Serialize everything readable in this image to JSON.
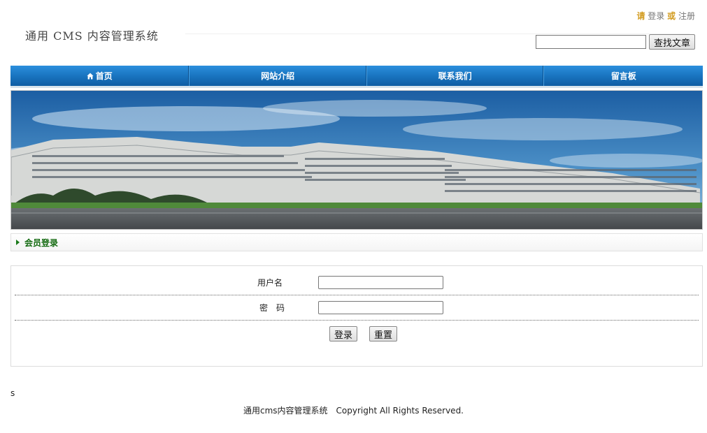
{
  "header": {
    "site_title": "通用 CMS 内容管理系统",
    "top_links": {
      "prefix": "请",
      "login": "登录",
      "or": "或",
      "register": "注册"
    },
    "search": {
      "placeholder": "",
      "value": "",
      "button_label": "查找文章"
    }
  },
  "nav": {
    "items": [
      {
        "label": "首页",
        "icon": "home-icon"
      },
      {
        "label": "网站介绍"
      },
      {
        "label": "联系我们"
      },
      {
        "label": "留言板"
      }
    ],
    "color": "#1872bd"
  },
  "banner": {
    "description_icon": "campus-building-photo"
  },
  "member_section": {
    "title": "会员登录",
    "accent_color": "#156b12"
  },
  "login_form": {
    "username_label": "用户名",
    "username_value": "",
    "password_label": "密　码",
    "password_value": "",
    "login_button": "登录",
    "reset_button": "重置"
  },
  "stray_text": "s",
  "footer": {
    "text": "通用cms内容管理系统　Copyright All Rights Reserved."
  }
}
